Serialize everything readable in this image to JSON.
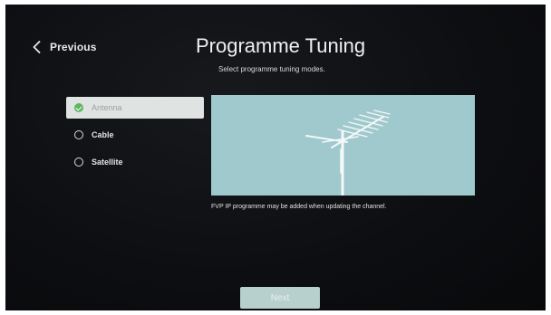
{
  "nav": {
    "back_label": "Previous"
  },
  "header": {
    "title": "Programme Tuning",
    "subtitle": "Select programme tuning modes."
  },
  "tuning_options": [
    {
      "label": "Antenna",
      "selected": true
    },
    {
      "label": "Cable",
      "selected": false
    },
    {
      "label": "Satellite",
      "selected": false
    }
  ],
  "preview": {
    "icon": "antenna-icon",
    "note": "FVP IP programme may be added when updating the channel."
  },
  "footer": {
    "next_label": "Next"
  },
  "colors": {
    "screen_background": "#0d0e11",
    "selected_option_background": "#dfe3e1",
    "check_accent": "#5cb85c",
    "preview_background": "#9fc9cd",
    "next_button": "#b7cfcd"
  }
}
